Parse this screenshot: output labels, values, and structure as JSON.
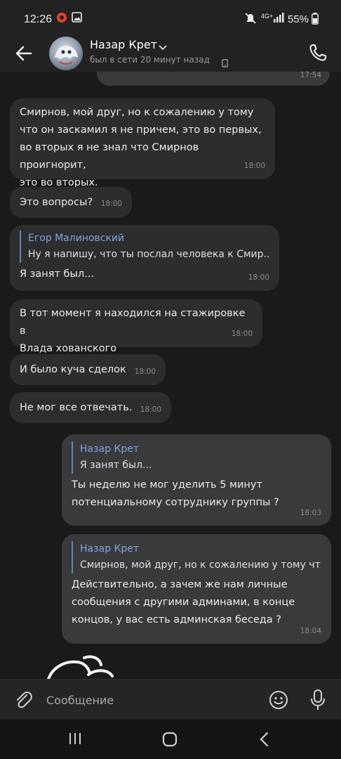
{
  "status_bar": {
    "time": "12:26",
    "network": "4G+",
    "battery": "55%"
  },
  "header": {
    "contact_name": "Назар Крет",
    "last_seen": "был в сети 20 минут назад"
  },
  "chat": {
    "top_partial_time": "17:54",
    "messages": [
      {
        "direction": "in",
        "text": "Смирнов, мой друг, но к сожалению у тому\nчто он заскамил я не причем, это во первых,\nво вторых я не знал что Смирнов проигнорит,\nэто во вторых.",
        "time": "18:00"
      },
      {
        "direction": "in",
        "text": "Это вопросы?",
        "time": "18:00"
      },
      {
        "direction": "in",
        "quote_author": "Егор Малиновский",
        "quote_text": "Ну я напишу, что ты послал человека к Смир...",
        "text": "Я занят был...",
        "time": "18:00"
      },
      {
        "direction": "in",
        "text": "В тот момент я находился на стажировке в\nВлада хованского",
        "time": "18:00"
      },
      {
        "direction": "in",
        "text": "И было куча сделок",
        "time": "18:00"
      },
      {
        "direction": "in",
        "text": "Не мог все отвечать.",
        "time": "18:00"
      },
      {
        "direction": "out",
        "quote_author": "Назар Крет",
        "quote_text": "Я занят был...",
        "text": "Ты неделю не мог уделить 5 минут\nпотенциальному сотруднику группы ?",
        "time": "18:03"
      },
      {
        "direction": "out",
        "quote_author": "Назар Крет",
        "quote_text": "Смирнов, мой друг, но к сожалению у тому чт...",
        "text": "Действительно, а зачем же нам личные\nсообщения с другими админами, в конце\nконцов, у вас есть админская беседа ?",
        "time": "18:04"
      }
    ]
  },
  "input": {
    "placeholder": "Сообщение"
  },
  "icons": {
    "back": "arrow-left-icon",
    "call": "phone-icon",
    "attach": "paperclip-icon",
    "emoji": "smile-icon",
    "mic": "microphone-icon"
  },
  "colors": {
    "background": "#1a1a1a",
    "incoming_bubble": "#2d2d2e",
    "outgoing_bubble": "#3a3a3c",
    "quote_accent": "#7ea3e0"
  }
}
